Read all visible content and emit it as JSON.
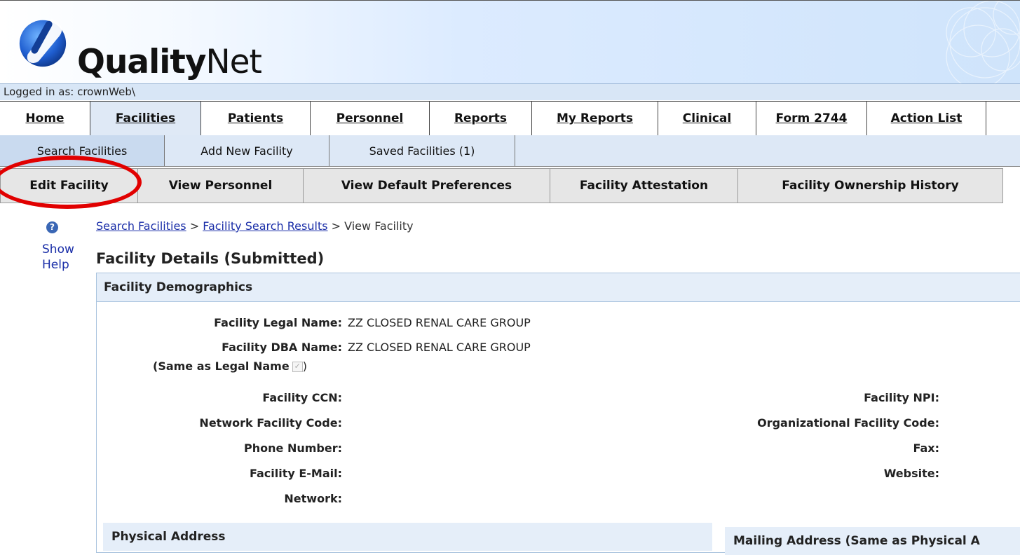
{
  "header": {
    "logo_bold": "Quality",
    "logo_light": "Net",
    "logged_in": "Logged in as: crownWeb\\"
  },
  "main_nav": [
    {
      "label": "Home",
      "active": false
    },
    {
      "label": "Facilities",
      "active": true
    },
    {
      "label": "Patients",
      "active": false
    },
    {
      "label": "Personnel",
      "active": false
    },
    {
      "label": "Reports",
      "active": false
    },
    {
      "label": "My Reports",
      "active": false
    },
    {
      "label": "Clinical",
      "active": false
    },
    {
      "label": "Form 2744",
      "active": false
    },
    {
      "label": "Action List",
      "active": false
    }
  ],
  "sub_nav": [
    {
      "label": "Search Facilities"
    },
    {
      "label": "Add New Facility"
    },
    {
      "label": "Saved Facilities (1)"
    }
  ],
  "third_nav": [
    {
      "label": "Edit Facility"
    },
    {
      "label": "View Personnel"
    },
    {
      "label": "View Default Preferences"
    },
    {
      "label": "Facility Attestation"
    },
    {
      "label": "Facility Ownership History"
    }
  ],
  "help": {
    "icon": "?",
    "label_line1": "Show",
    "label_line2": "Help"
  },
  "breadcrumb": {
    "crumb1": "Search Facilities",
    "sep": ">",
    "crumb2": "Facility Search Results",
    "current": "View Facility"
  },
  "page_title": "Facility Details (Submitted)",
  "demographics": {
    "header": "Facility Demographics",
    "legal_name_label": "Facility Legal Name:",
    "legal_name_value": "ZZ CLOSED RENAL CARE GROUP",
    "dba_name_label": "Facility DBA Name:",
    "dba_name_value": "ZZ CLOSED RENAL CARE GROUP",
    "same_as_legal_open": "(Same as Legal Name",
    "same_as_legal_close": ")",
    "ccn_label": "Facility CCN:",
    "npi_label": "Facility NPI:",
    "network_code_label": "Network Facility Code:",
    "org_code_label": "Organizational Facility Code:",
    "phone_label": "Phone Number:",
    "fax_label": "Fax:",
    "email_label": "Facility E-Mail:",
    "website_label": "Website:",
    "network_label": "Network:"
  },
  "physical_address": {
    "header": "Physical Address"
  },
  "mailing_address": {
    "header": "Mailing Address (Same as Physical A"
  },
  "colors": {
    "highlight_ring": "#e10000",
    "link": "#1a2ea8",
    "panel_header": "#e5eef9"
  }
}
